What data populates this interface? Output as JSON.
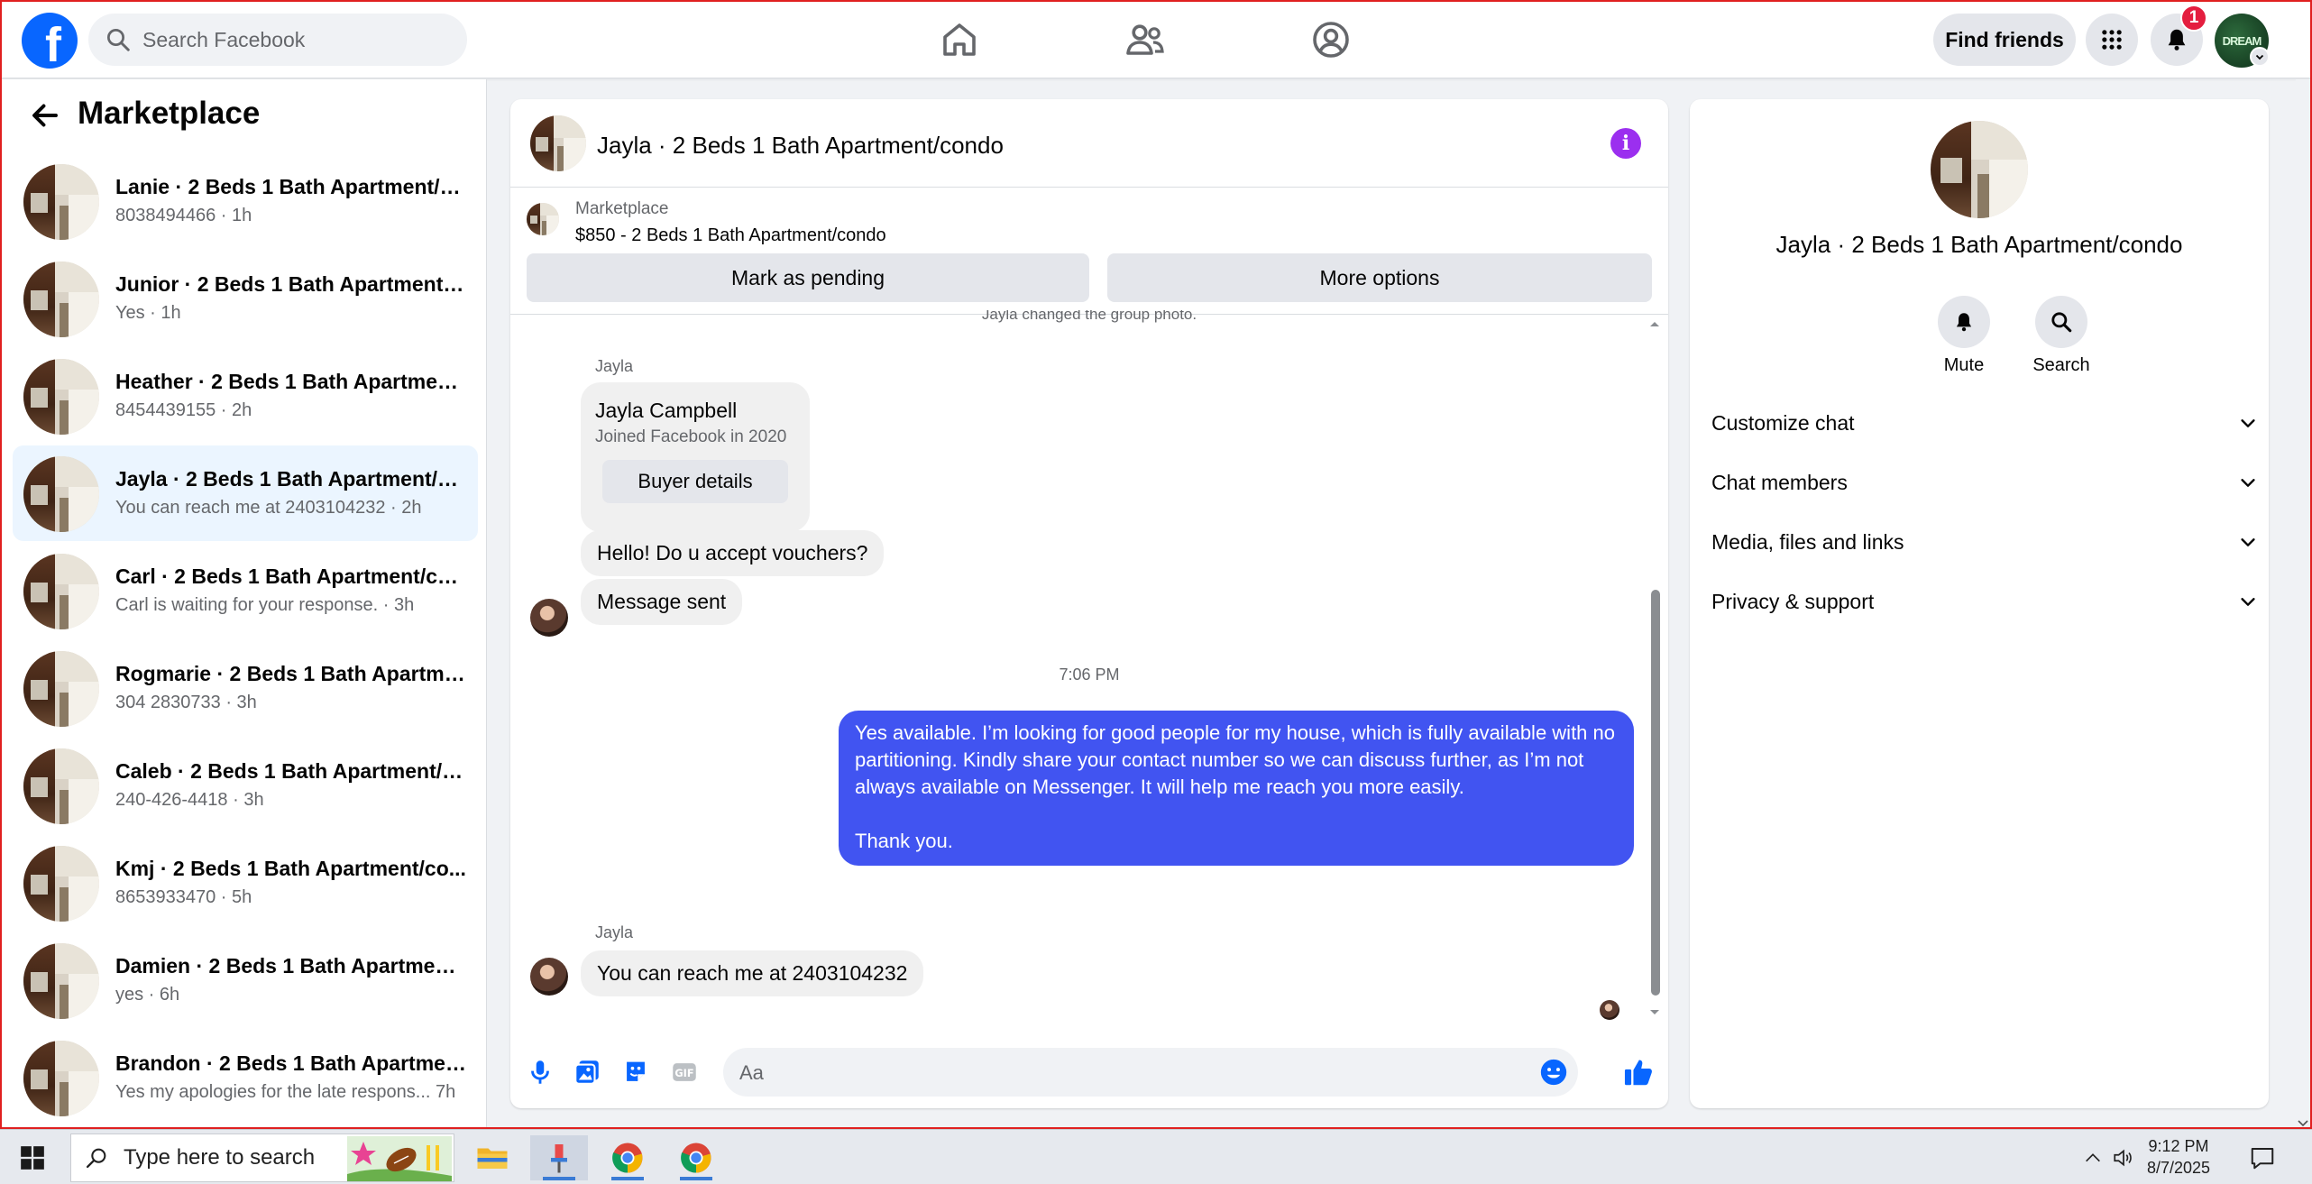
{
  "topbar": {
    "search_placeholder": "Search Facebook",
    "find_friends": "Find friends",
    "notif_count": "1",
    "avatar_text": "DREAM"
  },
  "sidebar": {
    "title": "Marketplace",
    "conversations": [
      {
        "name": "Lanie · 2 Beds 1 Bath Apartment/c...",
        "sub": "8038494466 · 1h",
        "active": false
      },
      {
        "name": "Junior · 2 Beds 1 Bath Apartment/c...",
        "sub": "Yes · 1h",
        "active": false
      },
      {
        "name": "Heather · 2 Beds 1 Bath Apartment...",
        "sub": "8454439155 · 2h",
        "active": false
      },
      {
        "name": "Jayla · 2 Beds 1 Bath Apartment/co...",
        "sub": "You can reach me at 2403104232 · 2h",
        "active": true
      },
      {
        "name": "Carl · 2 Beds 1 Bath Apartment/co...",
        "sub": "Carl is waiting for your response. · 3h",
        "active": false
      },
      {
        "name": "Rogmarie · 2 Beds 1 Bath Apartme...",
        "sub": "304 2830733 · 3h",
        "active": false
      },
      {
        "name": "Caleb · 2 Beds 1 Bath Apartment/c...",
        "sub": "240-426-4418 · 3h",
        "active": false
      },
      {
        "name": "Kmj · 2 Beds 1 Bath Apartment/co...",
        "sub": "8653933470 · 5h",
        "active": false
      },
      {
        "name": "Damien · 2 Beds 1 Bath Apartment...",
        "sub": "yes · 6h",
        "active": false
      },
      {
        "name": "Brandon · 2 Beds 1 Bath Apartmen...",
        "sub": "Yes my apologies for the late respons...   7h",
        "active": false
      }
    ]
  },
  "chat": {
    "title": "Jayla · 2 Beds 1 Bath Apartment/condo",
    "marketplace_label": "Marketplace",
    "listing": "$850 - 2 Beds 1 Bath Apartment/condo",
    "mark_pending": "Mark as pending",
    "more_options": "More options",
    "system_message": "Jayla changed the group photo.",
    "sender_name": "Jayla",
    "card_name": "Jayla Campbell",
    "card_joined": "Joined Facebook in 2020",
    "card_button": "Buyer details",
    "msg_vouchers": "Hello! Do u accept vouchers?",
    "msg_sent": "Message sent",
    "timestamp": "7:06 PM",
    "outgoing": "Yes available. I’m looking for good people for my house, which is fully available with no partitioning. Kindly share your contact number so we can discuss further, as I’m not always available on Messenger. It will help me reach you more easily.\n\nThank you.",
    "sender_name_2": "Jayla",
    "msg_reach": "You can reach me at 2403104232",
    "composer_placeholder": "Aa"
  },
  "info_panel": {
    "title": "Jayla · 2 Beds 1 Bath Apartment/condo",
    "mute_label": "Mute",
    "search_label": "Search",
    "sections": [
      "Customize chat",
      "Chat members",
      "Media, files and links",
      "Privacy & support"
    ]
  },
  "taskbar": {
    "search_placeholder": "Type here to search",
    "time": "9:12 PM",
    "date": "8/7/2025"
  },
  "colors": {
    "brand": "#0866ff",
    "outgoing_bubble": "#4154f1",
    "info_icon": "#9b2fef",
    "badge": "#e41e3f"
  }
}
